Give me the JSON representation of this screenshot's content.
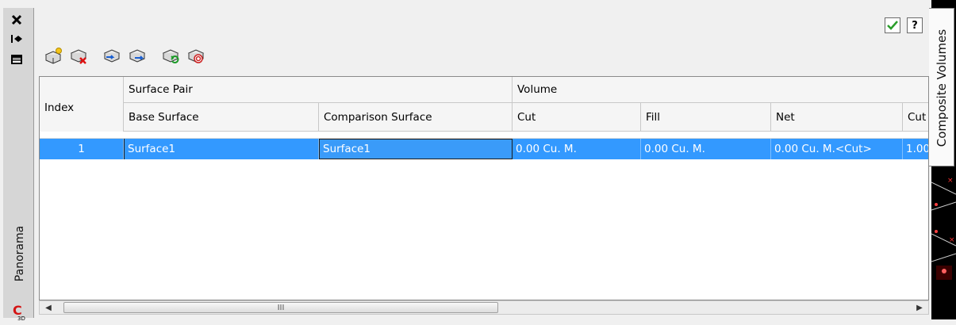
{
  "titlebar": {
    "vertical_label": "Panorama",
    "close_icon": "close-icon",
    "autohide_icon": "autohide-icon",
    "properties_icon": "properties-icon",
    "app_icon_letter": "C",
    "app_icon_sub": "3D"
  },
  "header_controls": {
    "ok_icon": "checkmark-icon",
    "help_label": "?"
  },
  "toolbar": {
    "tools": [
      {
        "icon": "create-volume-entry-icon"
      },
      {
        "icon": "delete-volume-entry-icon"
      },
      {
        "icon": "import-volume-entry-icon"
      },
      {
        "icon": "export-volume-entry-icon"
      },
      {
        "icon": "recompute-volumes-icon"
      },
      {
        "icon": "bounded-volume-icon"
      }
    ]
  },
  "table": {
    "columns": {
      "index": "Index",
      "surface_pair": "Surface Pair",
      "volume": "Volume",
      "base_surface": "Base Surface",
      "comparison_surface": "Comparison Surface",
      "cut": "Cut",
      "fill": "Fill",
      "net": "Net",
      "cut_factor": "Cut"
    },
    "rows": [
      {
        "index": "1",
        "base_surface": "Surface1",
        "comparison_surface": "Surface1",
        "cut": "0.00 Cu. M.",
        "fill": "0.00 Cu. M.",
        "net": "0.00 Cu. M.<Cut>",
        "cut_factor": "1.00"
      }
    ],
    "selected_row": 0
  },
  "scrollbar": {
    "grip": "III"
  },
  "right_tab": {
    "label": "Composite Volumes"
  },
  "colors": {
    "selection": "#3399ff",
    "panel_bg": "#f0f0f0",
    "accent_check": "#2a9d2a"
  }
}
